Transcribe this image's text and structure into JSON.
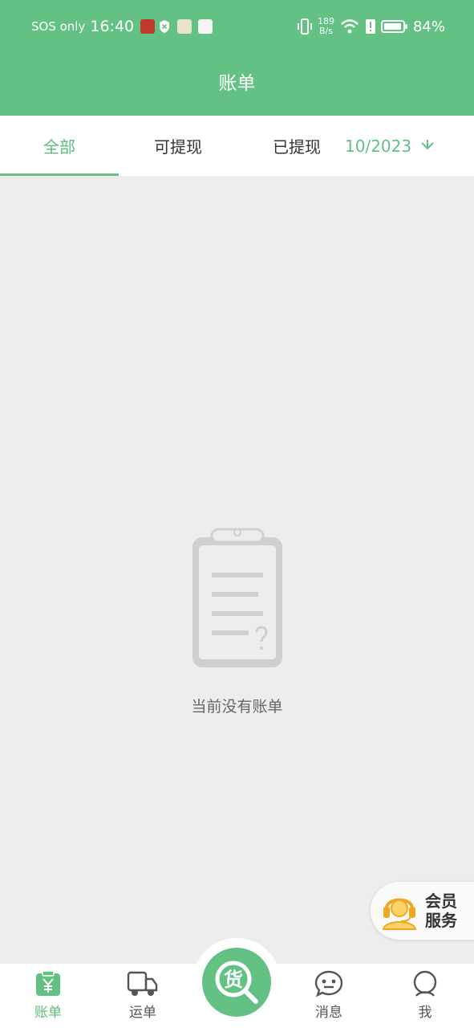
{
  "status_bar": {
    "carrier": "SOS only",
    "time": "16:40",
    "net_speed_value": "189",
    "net_speed_unit": "B/s",
    "battery": "84%"
  },
  "header": {
    "title": "账单"
  },
  "tabs": [
    {
      "label": "全部",
      "active": true
    },
    {
      "label": "可提现",
      "active": false
    },
    {
      "label": "已提现",
      "active": false
    }
  ],
  "month_picker": {
    "value": "10/2023"
  },
  "empty_state": {
    "message": "当前没有账单"
  },
  "member_service": {
    "line1": "会员",
    "line2": "服务"
  },
  "bottom_nav": [
    {
      "label": "账单",
      "icon": "bill-icon",
      "active": true
    },
    {
      "label": "运单",
      "icon": "truck-icon",
      "active": false
    },
    {
      "label": "消息",
      "icon": "message-icon",
      "active": false
    },
    {
      "label": "我",
      "icon": "profile-icon",
      "active": false
    }
  ],
  "fab": {
    "label": "货"
  },
  "colors": {
    "primary": "#63c184",
    "background": "#ededed",
    "text": "#333333"
  }
}
